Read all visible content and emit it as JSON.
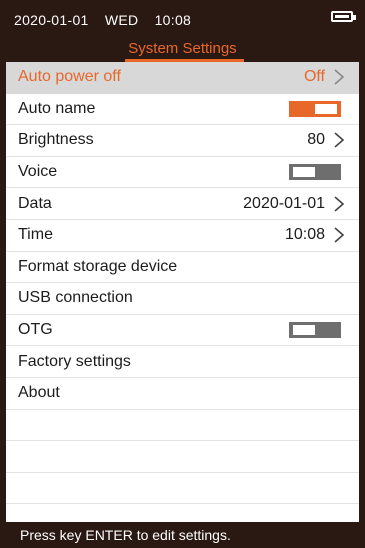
{
  "status_bar": {
    "date": "2020-01-01",
    "weekday": "WED",
    "time": "10:08",
    "battery_icon": "battery-full-icon"
  },
  "title": "System Settings",
  "settings": [
    {
      "label": "Auto power off",
      "value": "Off",
      "control": "chevron",
      "selected": true
    },
    {
      "label": "Auto name",
      "control": "toggle",
      "state": "on"
    },
    {
      "label": "Brightness",
      "value": "80",
      "control": "chevron"
    },
    {
      "label": "Voice",
      "control": "toggle",
      "state": "off"
    },
    {
      "label": "Data",
      "value": "2020-01-01",
      "control": "chevron"
    },
    {
      "label": "Time",
      "value": "10:08",
      "control": "chevron"
    },
    {
      "label": "Format storage device"
    },
    {
      "label": "USB connection"
    },
    {
      "label": "OTG",
      "control": "toggle",
      "state": "off"
    },
    {
      "label": "Factory settings"
    },
    {
      "label": "About"
    }
  ],
  "footer": "Press key ENTER to edit settings.",
  "colors": {
    "accent": "#e8682a",
    "bar_background": "#2a1812",
    "selected_row": "#d8d8d8",
    "toggle_off": "#6e6e6e"
  }
}
